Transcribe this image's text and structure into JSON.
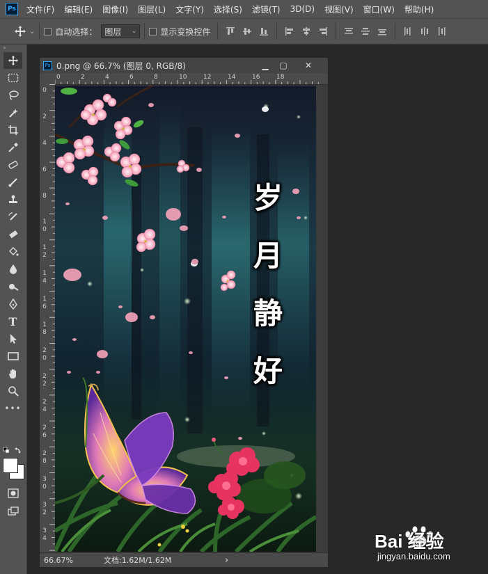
{
  "menubar": {
    "app_icon": "Ps",
    "items": [
      "文件(F)",
      "编辑(E)",
      "图像(I)",
      "图层(L)",
      "文字(Y)",
      "选择(S)",
      "滤镜(T)",
      "3D(D)",
      "视图(V)",
      "窗口(W)",
      "帮助(H)"
    ]
  },
  "options": {
    "auto_select_label": "自动选择：",
    "auto_select_value": "图层",
    "show_transform_label": "显示变换控件"
  },
  "toolbar": {
    "tools": [
      "move-tool-icon",
      "marquee-tool-icon",
      "lasso-tool-icon",
      "quick-select-tool-icon",
      "crop-tool-icon",
      "eyedropper-tool-icon",
      "healing-brush-tool-icon",
      "brush-tool-icon",
      "clone-stamp-tool-icon",
      "history-brush-tool-icon",
      "eraser-tool-icon",
      "paint-bucket-tool-icon",
      "blur-tool-icon",
      "dodge-tool-icon",
      "pen-tool-icon",
      "type-tool-icon",
      "path-select-tool-icon",
      "rectangle-tool-icon",
      "hand-tool-icon",
      "zoom-tool-icon",
      "more-tools-icon"
    ]
  },
  "document": {
    "icon": "Ps",
    "title": "0.png @ 66.7% (图层 0, RGB/8)",
    "minimize": "▁",
    "maximize": "▢",
    "close": "✕",
    "ruler_top": [
      "0",
      "2",
      "4",
      "6",
      "8",
      "10",
      "12",
      "14",
      "16",
      "18"
    ],
    "ruler_left": [
      "0",
      "2",
      "4",
      "6",
      "8",
      "10",
      "12",
      "14",
      "16",
      "18",
      "20",
      "22",
      "24",
      "26",
      "28",
      "30",
      "32",
      "34"
    ]
  },
  "canvas": {
    "poem": [
      "岁",
      "月",
      "静",
      "好"
    ]
  },
  "status": {
    "zoom": "66.67%",
    "doc_info": "文档:1.62M/1.62M",
    "arrow": "›"
  },
  "watermark": {
    "brand": "Bai 经验",
    "url": "jingyan.baidu.com"
  },
  "colors": {
    "ps_blue": "#31a8ff",
    "panel": "#535353",
    "workspace": "#282828"
  }
}
